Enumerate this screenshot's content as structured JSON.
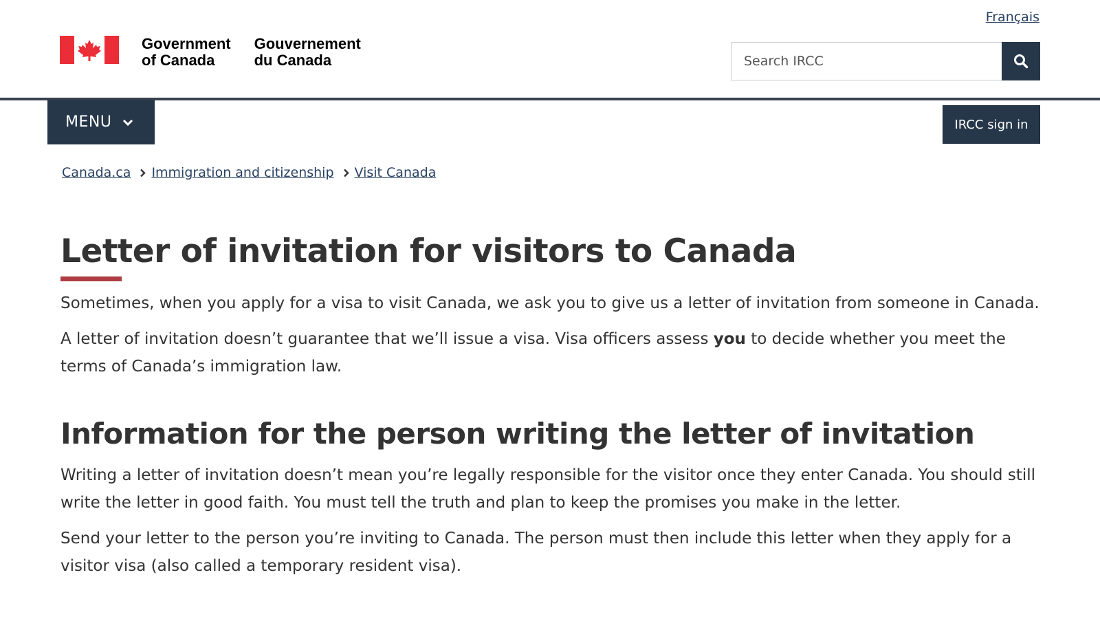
{
  "header": {
    "language_link": "Français",
    "signature": {
      "en_line1": "Government",
      "en_line2": "of Canada",
      "fr_line1": "Gouvernement",
      "fr_line2": "du Canada"
    },
    "search_placeholder": "Search IRCC",
    "menu_label": "MENU",
    "signin_label": "IRCC sign in"
  },
  "breadcrumb": [
    "Canada.ca",
    "Immigration and citizenship",
    "Visit Canada"
  ],
  "main": {
    "title": "Letter of invitation for visitors to Canada",
    "intro": "Sometimes, when you apply for a visa to visit Canada, we ask you to give us a letter of invitation from someone in Canada.",
    "guarantee_before": "A letter of invitation doesn’t guarantee that we’ll issue a visa. Visa officers assess ",
    "guarantee_bold": "you",
    "guarantee_after": " to decide whether you meet the terms of Canada’s immigration law.",
    "section_heading": "Information for the person writing the letter of invitation",
    "section_p1": "Writing a letter of invitation doesn’t mean you’re legally responsible for the visitor once they enter Canada. You should still write the letter in good faith. You must tell the truth and plan to keep the promises you make in the letter.",
    "section_p2": "Send your letter to the person you’re inviting to Canada. The person must then include this letter when they apply for a visitor visa (also called a temporary resident visa)."
  },
  "colors": {
    "navy": "#26374a",
    "link": "#284162",
    "flag_red": "#eb2d37",
    "accent_red": "#af3c43"
  },
  "icons": {
    "flag": "canada-flag-icon",
    "search": "search-icon",
    "menu": "chevron-down-icon",
    "breadcrumb_separator": "chevron-right-icon"
  }
}
